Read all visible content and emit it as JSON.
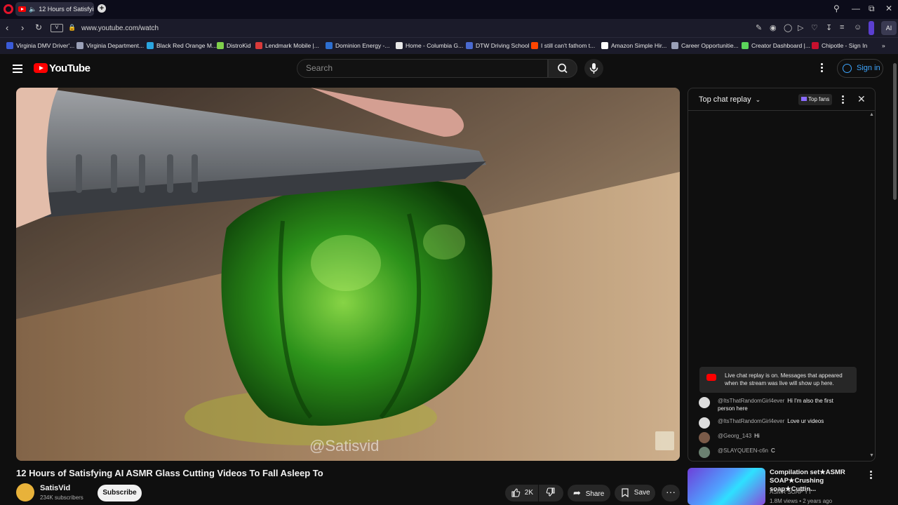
{
  "browser": {
    "tab_title": "12 Hours of Satisfying",
    "url": "www.youtube.com/watch",
    "v_badge": "V",
    "ai_label": "AI",
    "bookmarks": [
      {
        "label": "Virginia DMV Driver'...",
        "color": "#3a5bd9"
      },
      {
        "label": "Virginia Department...",
        "color": "#9aa0b8"
      },
      {
        "label": "Black Red Orange M...",
        "color": "#2aa5e0"
      },
      {
        "label": "DistroKid",
        "color": "#7fd04b"
      },
      {
        "label": "Lendmark Mobile |...",
        "color": "#d93a3a"
      },
      {
        "label": "Dominion Energy -...",
        "color": "#2d6fd1"
      },
      {
        "label": "Home - Columbia G...",
        "color": "#e8e8e8"
      },
      {
        "label": "DTW Driving School",
        "color": "#4a6ad0"
      },
      {
        "label": "I still can't fathom t...",
        "color": "#ff4500"
      },
      {
        "label": "Amazon Simple Hir...",
        "color": "#ffffff"
      },
      {
        "label": "Career Opportunitie...",
        "color": "#9aa0b8"
      },
      {
        "label": "Creator Dashboard |...",
        "color": "#5bd45b"
      },
      {
        "label": "Chipotle - Sign In",
        "color": "#c8102e"
      }
    ]
  },
  "yt": {
    "logo_text": "YouTube",
    "search_placeholder": "Search",
    "sign_in": "Sign in"
  },
  "video": {
    "watermark": "@Satisvid",
    "title": "12 Hours of Satisfying AI ASMR Glass Cutting Videos To Fall Asleep To",
    "channel": "SatisVid",
    "subscribers": "234K subscribers",
    "subscribe": "Subscribe",
    "likes": "2K",
    "share": "Share",
    "save": "Save"
  },
  "chat": {
    "title": "Top chat replay",
    "top_fans": "Top fans",
    "notice": "Live chat replay is on. Messages that appeared when the stream was live will show up here.",
    "messages": [
      {
        "author": "@ItsThatRandomGirl4ever",
        "text": "Hi I'm also the first person here"
      },
      {
        "author": "@ItsThatRandomGirl4ever",
        "text": "Love ur videos"
      },
      {
        "author": "@Georg_143",
        "text": "Hi"
      },
      {
        "author": "@SLAYQUEEN-c6n",
        "text": "C"
      }
    ]
  },
  "recommendation": {
    "title": "Compilation set★ASMR SOAP★Crushing soap★Cuttin...",
    "channel": "ASMR SOAP YT",
    "meta": "1.8M views • 2 years ago"
  }
}
